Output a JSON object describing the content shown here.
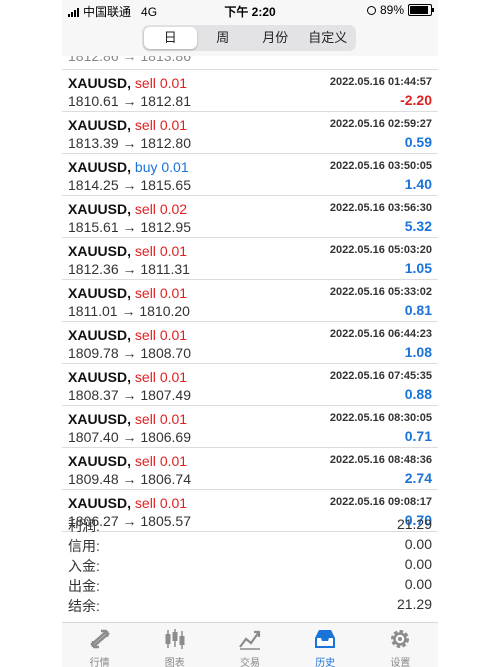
{
  "status": {
    "carrier": "中国联通",
    "network": "4G",
    "time": "下午 2:20",
    "battery": "89%",
    "battery_level": 0.89
  },
  "tabs_top": [
    {
      "label": "日",
      "active": true
    },
    {
      "label": "周",
      "active": false
    },
    {
      "label": "月份",
      "active": false
    },
    {
      "label": "自定义",
      "active": false
    }
  ],
  "trades": [
    {
      "symbol": "XAUUSD,",
      "side": "sell",
      "lots": "0.01",
      "open": "1810.61",
      "arrow": "→",
      "close": "1812.81",
      "datetime": "2022.05.16 01:44:57",
      "profit": "-2.20",
      "negative": true
    },
    {
      "symbol": "XAUUSD,",
      "side": "sell",
      "lots": "0.01",
      "open": "1813.39",
      "arrow": "→",
      "close": "1812.80",
      "datetime": "2022.05.16 02:59:27",
      "profit": "0.59",
      "negative": false
    },
    {
      "symbol": "XAUUSD,",
      "side": "buy",
      "lots": "0.01",
      "open": "1814.25",
      "arrow": "→",
      "close": "1815.65",
      "datetime": "2022.05.16 03:50:05",
      "profit": "1.40",
      "negative": false
    },
    {
      "symbol": "XAUUSD,",
      "side": "sell",
      "lots": "0.02",
      "open": "1815.61",
      "arrow": "→",
      "close": "1812.95",
      "datetime": "2022.05.16 03:56:30",
      "profit": "5.32",
      "negative": false
    },
    {
      "symbol": "XAUUSD,",
      "side": "sell",
      "lots": "0.01",
      "open": "1812.36",
      "arrow": "→",
      "close": "1811.31",
      "datetime": "2022.05.16 05:03:20",
      "profit": "1.05",
      "negative": false
    },
    {
      "symbol": "XAUUSD,",
      "side": "sell",
      "lots": "0.01",
      "open": "1811.01",
      "arrow": "→",
      "close": "1810.20",
      "datetime": "2022.05.16 05:33:02",
      "profit": "0.81",
      "negative": false
    },
    {
      "symbol": "XAUUSD,",
      "side": "sell",
      "lots": "0.01",
      "open": "1809.78",
      "arrow": "→",
      "close": "1808.70",
      "datetime": "2022.05.16 06:44:23",
      "profit": "1.08",
      "negative": false
    },
    {
      "symbol": "XAUUSD,",
      "side": "sell",
      "lots": "0.01",
      "open": "1808.37",
      "arrow": "→",
      "close": "1807.49",
      "datetime": "2022.05.16 07:45:35",
      "profit": "0.88",
      "negative": false
    },
    {
      "symbol": "XAUUSD,",
      "side": "sell",
      "lots": "0.01",
      "open": "1807.40",
      "arrow": "→",
      "close": "1806.69",
      "datetime": "2022.05.16 08:30:05",
      "profit": "0.71",
      "negative": false
    },
    {
      "symbol": "XAUUSD,",
      "side": "sell",
      "lots": "0.01",
      "open": "1809.48",
      "arrow": "→",
      "close": "1806.74",
      "datetime": "2022.05.16 08:48:36",
      "profit": "2.74",
      "negative": false
    },
    {
      "symbol": "XAUUSD,",
      "side": "sell",
      "lots": "0.01",
      "open": "1806.27",
      "arrow": "→",
      "close": "1805.57",
      "datetime": "2022.05.16 09:08:17",
      "profit": "0.70",
      "negative": false
    }
  ],
  "summary": [
    {
      "label": "利润:",
      "value": "21.29"
    },
    {
      "label": "信用:",
      "value": "0.00"
    },
    {
      "label": "入金:",
      "value": "0.00"
    },
    {
      "label": "出金:",
      "value": "0.00"
    },
    {
      "label": "结余:",
      "value": "21.29"
    }
  ],
  "tabbar": [
    {
      "label": "行情",
      "icon": "quotes-icon",
      "active": false
    },
    {
      "label": "图表",
      "icon": "chart-icon",
      "active": false
    },
    {
      "label": "交易",
      "icon": "trade-icon",
      "active": false
    },
    {
      "label": "历史",
      "icon": "history-icon",
      "active": true
    },
    {
      "label": "设置",
      "icon": "settings-icon",
      "active": false
    }
  ],
  "colors": {
    "sell": "#e02020",
    "buy": "#1a73d9",
    "accent": "#1a73d9",
    "inactive": "#8c8c8c"
  }
}
